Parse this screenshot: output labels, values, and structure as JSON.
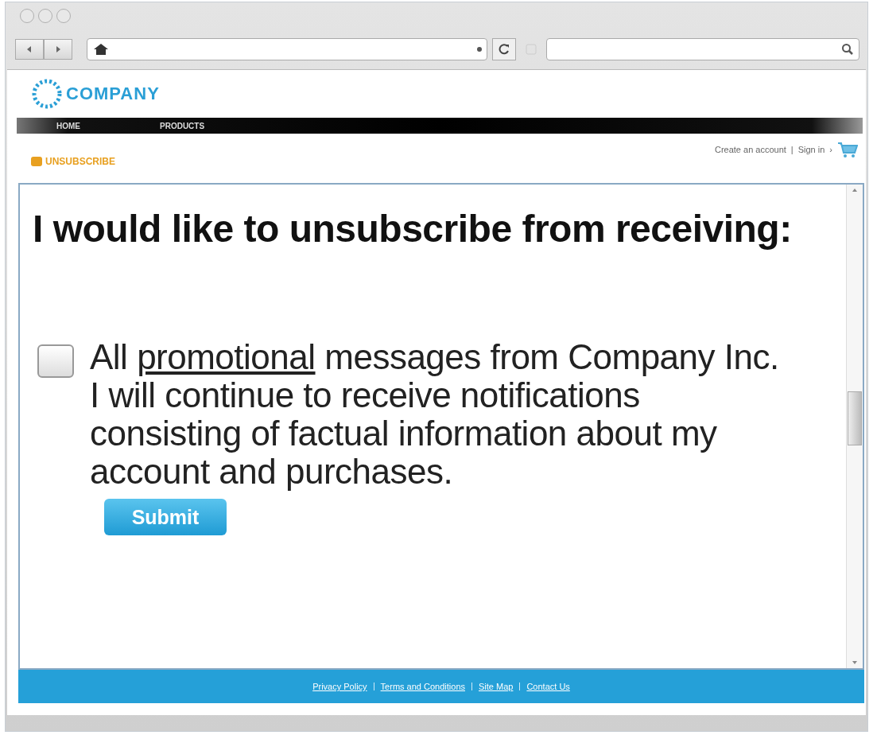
{
  "site": {
    "logo": "COMPANY",
    "nav": [
      {
        "label": "HOME"
      },
      {
        "label": "PRODUCTS"
      }
    ],
    "breadcrumb": "UNSUBSCRIBE",
    "account_links": [
      "Create an account",
      "|",
      "Sign in",
      "›"
    ]
  },
  "form": {
    "heading": "I would like to unsubscribe from receiving:",
    "option": {
      "checked": false,
      "prefix": "All ",
      "link": "promotional",
      "suffix": " messages from Company Inc.\nI will continue to receive notifications\nconsisting of factual information about my\naccount and purchases."
    },
    "submit": "Submit"
  },
  "footer": {
    "links": [
      "Privacy Policy",
      "Terms and Conditions",
      "Site Map",
      "Contact Us"
    ]
  }
}
